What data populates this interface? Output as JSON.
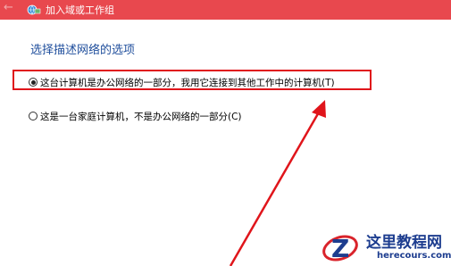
{
  "titlebar": {
    "title": "加入域或工作组",
    "back_icon": "back-arrow-icon",
    "app_icon": "network-globe-icon",
    "color": "#e8484e"
  },
  "main": {
    "heading": "选择描述网络的选项",
    "options": [
      {
        "label": "这台计算机是办公网络的一部分，我用它连接到其他工作中的计算机(T)",
        "selected": true
      },
      {
        "label": "这是一台家庭计算机，不是办公网络的一部分(C)",
        "selected": false
      }
    ]
  },
  "annotation": {
    "highlight_color": "#e0151b",
    "arrow_color": "#e0151b"
  },
  "watermark": {
    "name": "这里教程网",
    "url": "herecours.com"
  }
}
